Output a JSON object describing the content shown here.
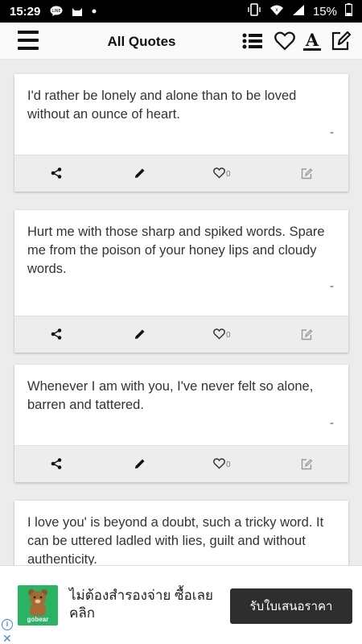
{
  "status": {
    "time": "15:29",
    "battery": "15%"
  },
  "header": {
    "title": "All Quotes"
  },
  "quotes": [
    {
      "text": "I'd rather be lonely and alone than to be loved without an ounce of heart.",
      "author": "-",
      "likes": "0"
    },
    {
      "text": "Hurt me with those sharp and spiked words. Spare me from the poison of your honey lips and cloudy words.",
      "author": "-",
      "likes": "0"
    },
    {
      "text": "Whenever I am with you, I've never felt so alone, barren and tattered.",
      "author": "-",
      "likes": "0"
    },
    {
      "text": "I love you' is beyond a doubt, such a tricky word. It can be uttered ladled with lies, guilt and without authenticity.",
      "author": "",
      "likes": ""
    }
  ],
  "ad": {
    "brand": "gobear",
    "text": "ไม่ต้องสำรองจ่าย ซื้อเลย คลิก",
    "cta": "รับใบเสนอราคา"
  },
  "icons": {
    "menu": "menu-icon",
    "list": "list-icon",
    "heart": "heart-icon",
    "font": "font-icon",
    "compose": "compose-icon",
    "share": "share-icon",
    "edit": "pencil-icon",
    "like": "heart-outline-icon",
    "note": "note-edit-icon"
  }
}
